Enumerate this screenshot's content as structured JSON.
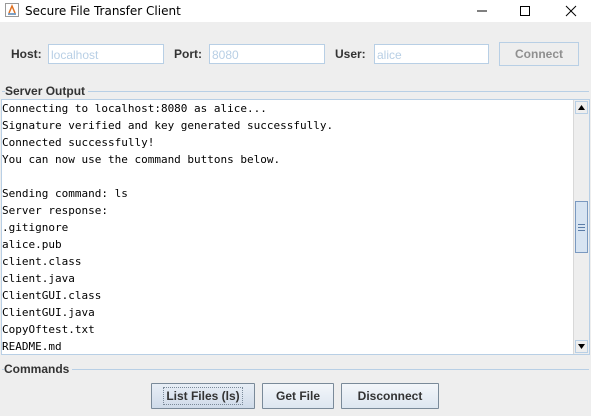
{
  "window": {
    "title": "Secure File Transfer Client"
  },
  "connection": {
    "host_label": "Host:",
    "host_value": "localhost",
    "port_label": "Port:",
    "port_value": "8080",
    "user_label": "User:",
    "user_value": "alice",
    "connect_label": "Connect"
  },
  "server_output": {
    "title": "Server Output",
    "lines": [
      "Connecting to localhost:8080 as alice...",
      "Signature verified and key generated successfully.",
      "Connected successfully!",
      "You can now use the command buttons below.",
      "",
      "Sending command: ls",
      "Server response:",
      ".gitignore",
      "alice.pub",
      "client.class",
      "client.java",
      "ClientGUI.class",
      "ClientGUI.java",
      "CopyOftest.txt",
      "README.md"
    ]
  },
  "commands": {
    "title": "Commands",
    "list_files_label": "List Files (ls)",
    "get_file_label": "Get File",
    "disconnect_label": "Disconnect"
  },
  "colors": {
    "accent_border": "#b8cfe5",
    "disabled_text": "#b8cfe5",
    "background": "#eeeeee"
  }
}
